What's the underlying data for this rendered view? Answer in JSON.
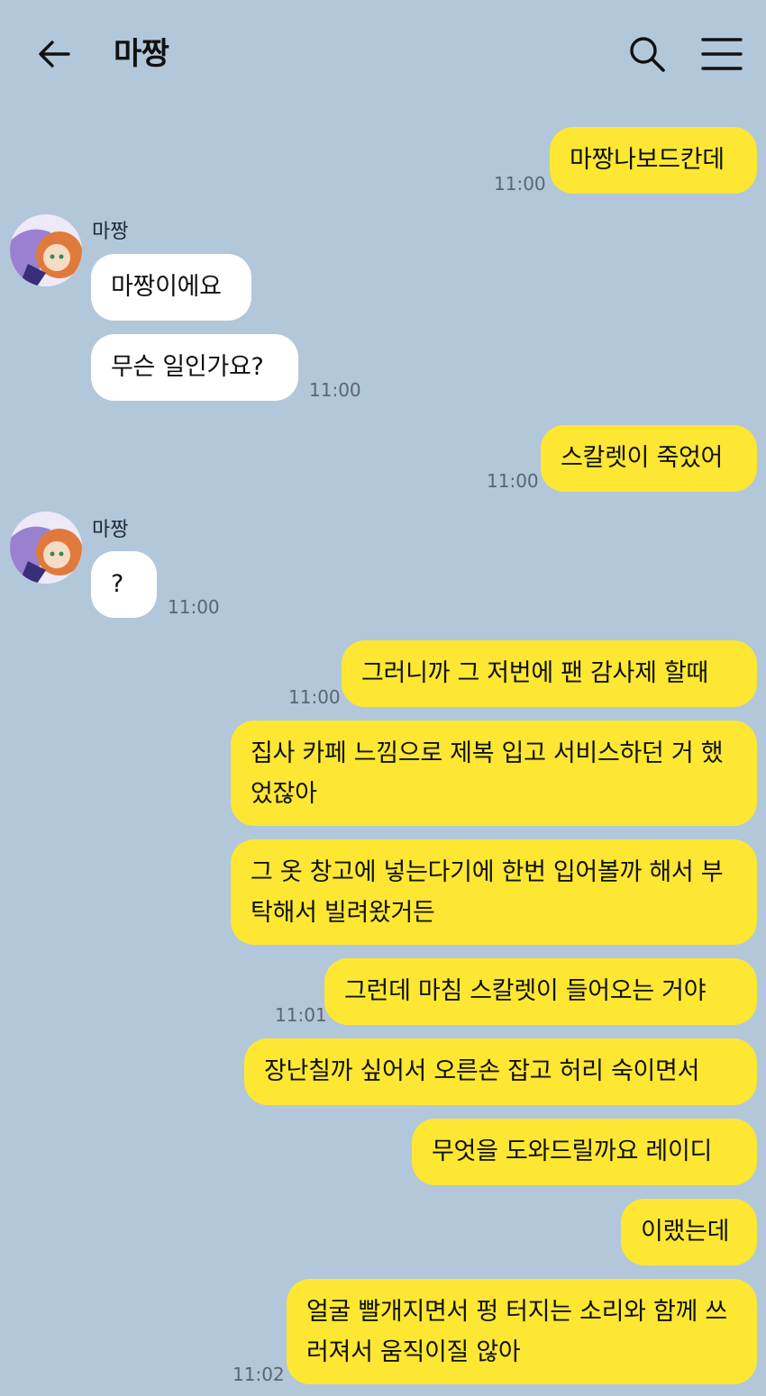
{
  "header": {
    "title": "마짱",
    "back_icon": "back-arrow-icon",
    "search_icon": "search-icon",
    "menu_icon": "hamburger-menu-icon"
  },
  "colors": {
    "background": "#b2c7da",
    "my_bubble": "#fde732",
    "other_bubble": "#ffffff"
  },
  "messages": [
    {
      "from": "me",
      "text": "마짱나보드칸데",
      "time": "11:00"
    },
    {
      "from": "other",
      "sender": "마짱",
      "text": "마짱이에요"
    },
    {
      "from": "other",
      "text": "무슨 일인가요?",
      "time": "11:00"
    },
    {
      "from": "me",
      "text": "스칼렛이 죽었어",
      "time": "11:00"
    },
    {
      "from": "other",
      "sender": "마짱",
      "text": "?",
      "time": "11:00"
    },
    {
      "from": "me",
      "text": "그러니까 그 저번에 팬 감사제 할때",
      "time": "11:00"
    },
    {
      "from": "me",
      "text": "집사 카페 느낌으로 제복 입고 서비스하던 거 했었잖아"
    },
    {
      "from": "me",
      "text": "그 옷 창고에 넣는다기에 한번 입어볼까 해서 부탁해서 빌려왔거든"
    },
    {
      "from": "me",
      "text": "그런데 마침 스칼렛이 들어오는 거야",
      "time": "11:01"
    },
    {
      "from": "me",
      "text": "장난칠까 싶어서 오른손 잡고 허리 숙이면서"
    },
    {
      "from": "me",
      "text": "무엇을 도와드릴까요 레이디"
    },
    {
      "from": "me",
      "text": "이랬는데"
    },
    {
      "from": "me",
      "text": "얼굴 빨개지면서 펑 터지는 소리와 함께 쓰러져서 움직이질 않아",
      "time": "11:02"
    }
  ]
}
